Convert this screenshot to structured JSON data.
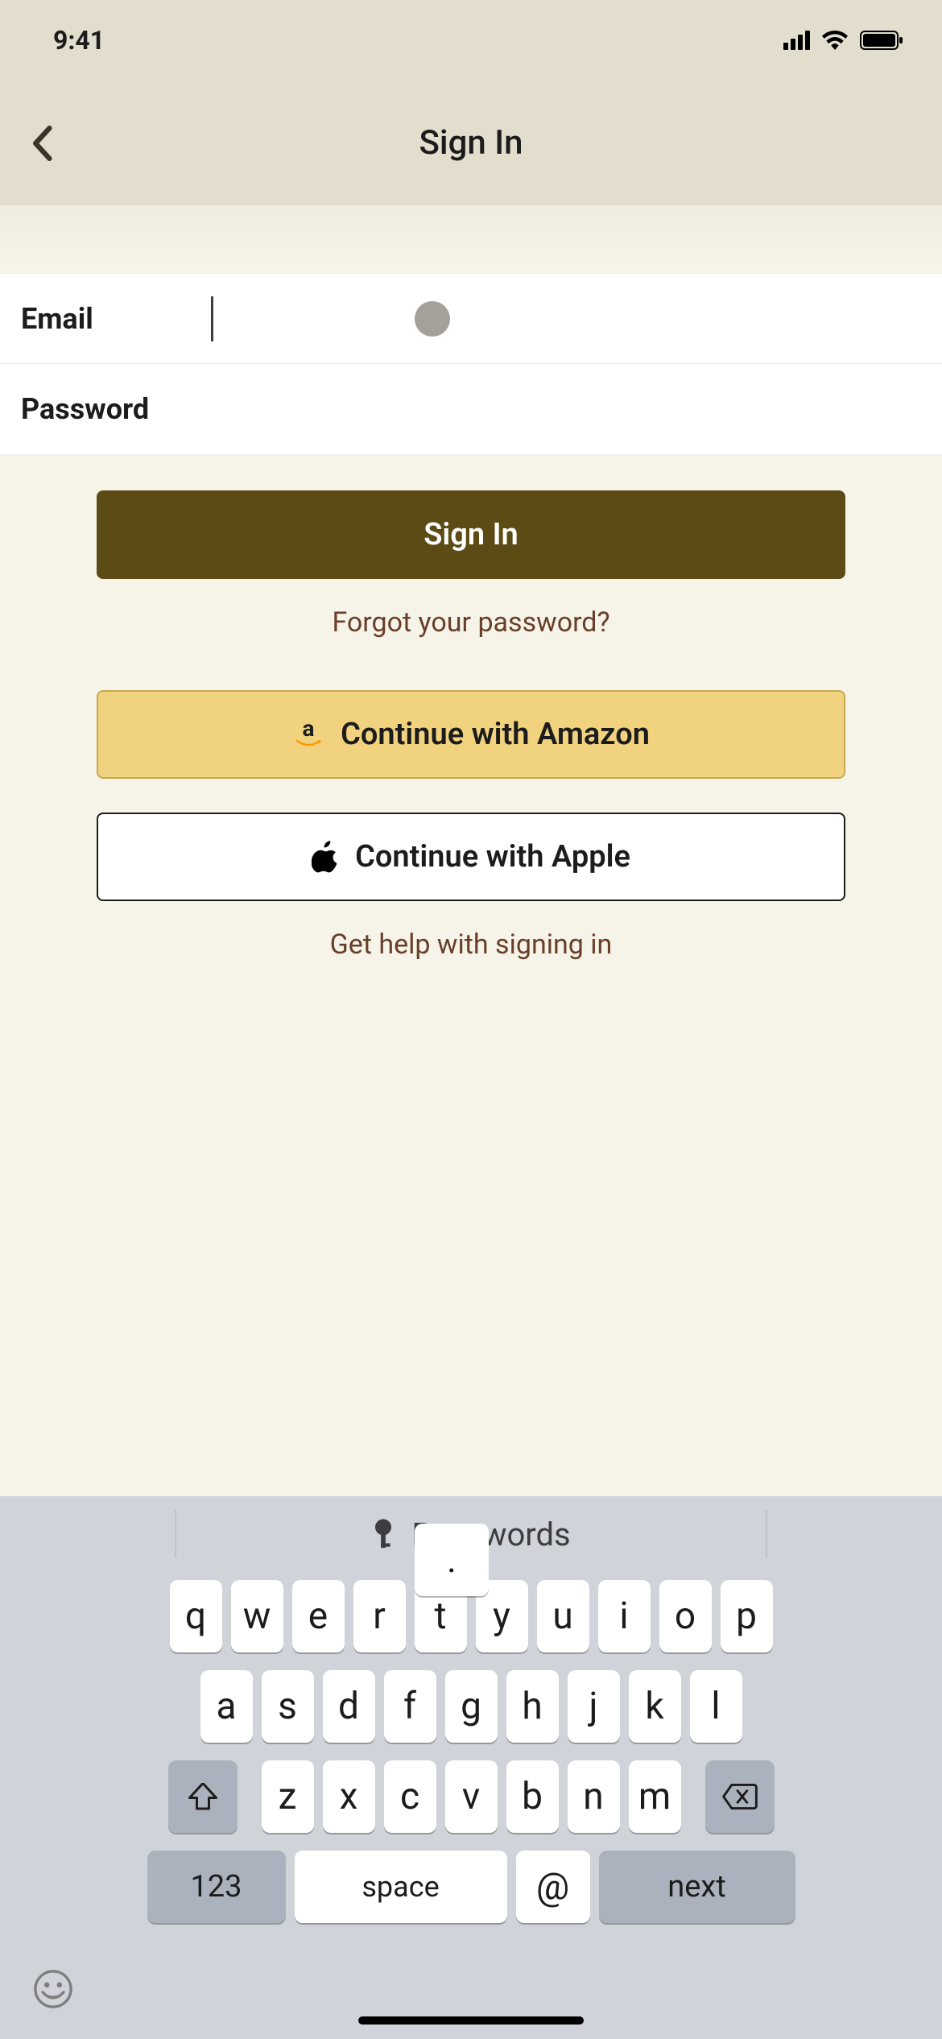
{
  "status": {
    "time": "9:41"
  },
  "nav": {
    "title": "Sign In"
  },
  "form": {
    "email_label": "Email",
    "email_value": "",
    "password_label": "Password",
    "password_value": ""
  },
  "actions": {
    "signin": "Sign In",
    "forgot": "Forgot your password?",
    "amazon": " Continue with Amazon",
    "apple": "Continue with Apple",
    "help": "Get help with signing in"
  },
  "keyboard": {
    "suggestion": "Passwords",
    "row1": [
      "q",
      "w",
      "e",
      "r",
      "t",
      "y",
      "u",
      "i",
      "o",
      "p"
    ],
    "row2": [
      "a",
      "s",
      "d",
      "f",
      "g",
      "h",
      "j",
      "k",
      "l"
    ],
    "row3": [
      "z",
      "x",
      "c",
      "v",
      "b",
      "n",
      "m"
    ],
    "numkey": "123",
    "space": "space",
    "at": "@",
    "dot": ".",
    "next": "next"
  }
}
